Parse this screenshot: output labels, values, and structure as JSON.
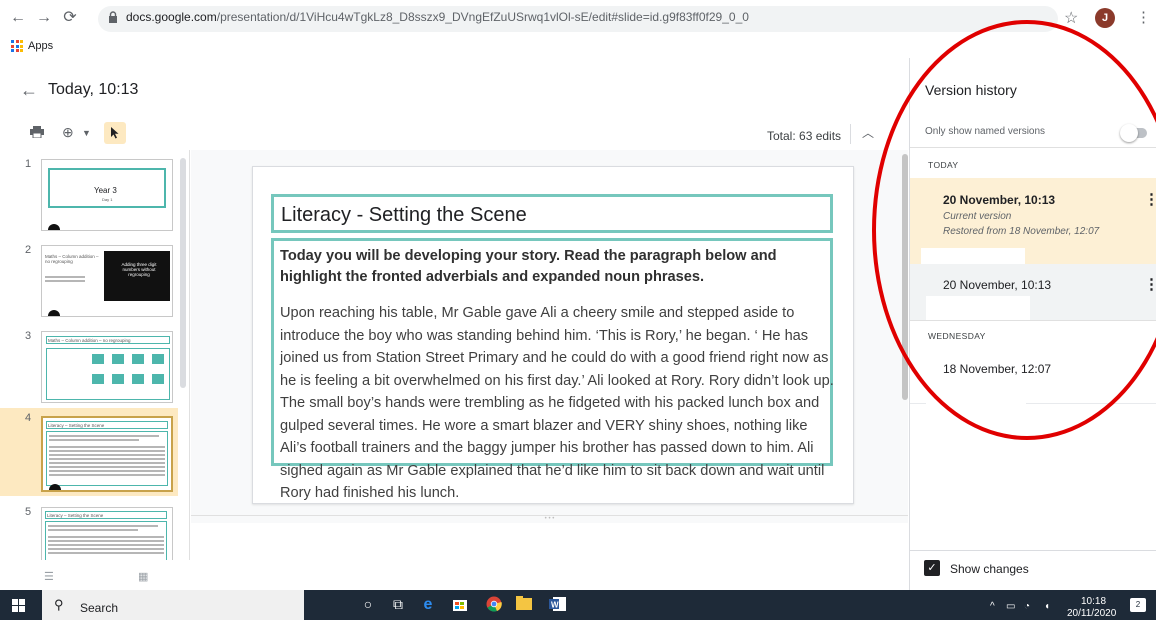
{
  "browser": {
    "url_host": "docs.google.com",
    "url_path": "/presentation/d/1ViHcu4wTgkLz8_D8sszx9_DVngEfZuUSrwq1vlOl-sE/edit#slide=id.g9f83ff0f29_0_0",
    "avatar_letter": "J",
    "bookmarks_apps": "Apps"
  },
  "header": {
    "title": "Today, 10:13",
    "total_edits": "Total: 63 edits"
  },
  "filmstrip": {
    "slides": [
      {
        "num": "1",
        "title": "Year 3",
        "sub": "Day 1"
      },
      {
        "num": "2",
        "title": "Maths – Column addition – no regrouping",
        "dark_text": "Adding three digit numbers without regrouping"
      },
      {
        "num": "3",
        "title": "Maths – Column addition – no regrouping"
      },
      {
        "num": "4",
        "title": "Literacy – Setting the Scene"
      },
      {
        "num": "5",
        "title": "Literacy – Setting the Scene"
      }
    ]
  },
  "slide": {
    "title": "Literacy - Setting the Scene",
    "lead": "Today you will be developing your story. Read the paragraph below and highlight the fronted adverbials and expanded noun phrases.",
    "paragraph": "Upon reaching his table, Mr Gable gave Ali a cheery smile and stepped aside to introduce the boy who was standing behind him. ‘This is Rory,’ he began. ‘ He has joined us from Station Street Primary and he could do with a good friend right now as he is feeling a bit overwhelmed on his first day.’ Ali looked at Rory. Rory didn’t look up. The small boy’s hands were trembling as he fidgeted with his packed lunch box and gulped several times. He wore a smart blazer and VERY shiny shoes, nothing like Ali’s football trainers and the baggy jumper his brother has passed down to him. Ali sighed again as Mr Gable explained that he’d like him to sit back down and wait until Rory had finished his lunch."
  },
  "version_history": {
    "title": "Version history",
    "named_only_label": "Only show named versions",
    "named_only_on": false,
    "sections": [
      {
        "label": "TODAY"
      },
      {
        "label": "WEDNESDAY"
      }
    ],
    "versions": [
      {
        "date": "20 November, 10:13",
        "sub1": "Current version",
        "sub2": "Restored from 18 November, 12:07"
      },
      {
        "date": "20 November, 10:13"
      },
      {
        "date": "18 November, 12:07"
      }
    ],
    "show_changes_label": "Show changes",
    "show_changes_checked": true
  },
  "taskbar": {
    "search_label": "Search",
    "time": "10:18",
    "date": "20/11/2020",
    "notifications": "2"
  },
  "colors": {
    "accent_teal": "#76c7bd",
    "highlight": "#fde9c1",
    "annotation_red": "#e00000"
  }
}
